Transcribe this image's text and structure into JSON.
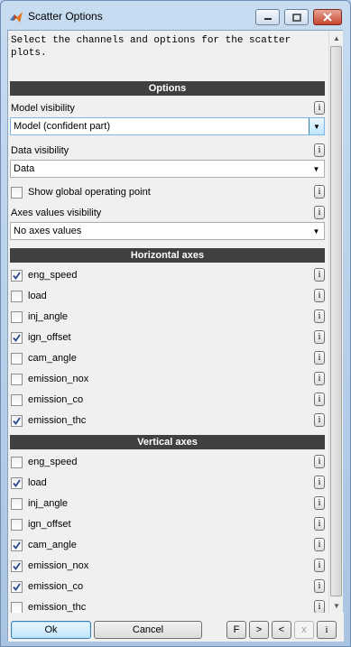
{
  "window": {
    "title": "Scatter Options"
  },
  "intro": "Select the channels and options for the scatter plots.",
  "info_glyph": "i",
  "options": {
    "header": "Options",
    "model_visibility": {
      "label": "Model visibility",
      "value": "Model (confident part)"
    },
    "data_visibility": {
      "label": "Data visibility",
      "value": "Data"
    },
    "global_op": {
      "label": "Show global operating point",
      "checked": false
    },
    "axes_values": {
      "label": "Axes values visibility",
      "value": "No axes values"
    }
  },
  "horizontal": {
    "header": "Horizontal axes",
    "items": [
      {
        "label": "eng_speed",
        "checked": true
      },
      {
        "label": "load",
        "checked": false
      },
      {
        "label": "inj_angle",
        "checked": false
      },
      {
        "label": "ign_offset",
        "checked": true
      },
      {
        "label": "cam_angle",
        "checked": false
      },
      {
        "label": "emission_nox",
        "checked": false
      },
      {
        "label": "emission_co",
        "checked": false
      },
      {
        "label": "emission_thc",
        "checked": true
      }
    ]
  },
  "vertical": {
    "header": "Vertical axes",
    "items": [
      {
        "label": "eng_speed",
        "checked": false
      },
      {
        "label": "load",
        "checked": true
      },
      {
        "label": "inj_angle",
        "checked": false
      },
      {
        "label": "ign_offset",
        "checked": false
      },
      {
        "label": "cam_angle",
        "checked": true
      },
      {
        "label": "emission_nox",
        "checked": true
      },
      {
        "label": "emission_co",
        "checked": true
      },
      {
        "label": "emission_thc",
        "checked": false
      }
    ]
  },
  "buttons": {
    "ok": "Ok",
    "cancel": "Cancel",
    "f": "F",
    "next": ">",
    "prev": "<",
    "close": "x",
    "info": "i"
  }
}
